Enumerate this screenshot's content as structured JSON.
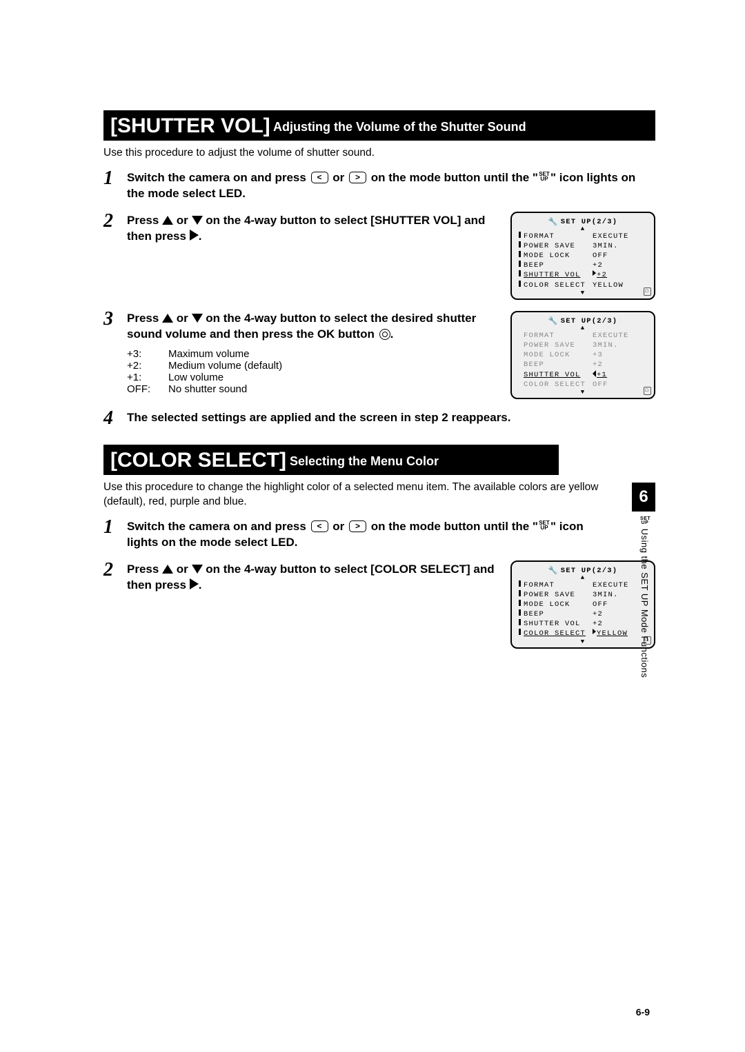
{
  "section1": {
    "header_bracket": "[SHUTTER VOL]",
    "header_sub": " Adjusting the Volume of the Shutter Sound",
    "intro": "Use this procedure to adjust the volume of shutter sound.",
    "steps": {
      "s1": {
        "num": "1",
        "pre": "Switch the camera on and press ",
        "mid": " or ",
        "post1": " on the mode button until the \"",
        "post2": "\" icon lights on the mode select LED.",
        "setup_top": "SET",
        "setup_bot": "UP"
      },
      "s2": {
        "num": "2",
        "pre": "Press ",
        "mid": " or ",
        "post": " on the 4-way button to select [SHUTTER VOL] and then press ",
        "end": "."
      },
      "s3": {
        "num": "3",
        "pre": "Press ",
        "mid": " or ",
        "post": " on the 4-way button to select the desired shutter sound volume and then press the OK button ",
        "end": "."
      },
      "s4": {
        "num": "4",
        "text": "The selected settings are applied and the screen in step 2 reappears."
      }
    },
    "vol_levels": [
      {
        "k": "+3:",
        "v": "Maximum volume"
      },
      {
        "k": "+2:",
        "v": "Medium volume (default)"
      },
      {
        "k": "+1:",
        "v": "Low volume"
      },
      {
        "k": "OFF:",
        "v": "No shutter sound"
      }
    ]
  },
  "section2": {
    "header_bracket": "[COLOR SELECT]",
    "header_sub": " Selecting the Menu Color",
    "intro": "Use this procedure to change the highlight color of a selected menu item. The available colors are yellow (default), red, purple and blue.",
    "steps": {
      "s1": {
        "num": "1",
        "pre": "Switch the camera on and press ",
        "mid": " or ",
        "post1": " on the mode button until the \"",
        "post2": "\" icon lights on the mode select LED.",
        "setup_top": "SET",
        "setup_bot": "UP"
      },
      "s2": {
        "num": "2",
        "pre": "Press ",
        "mid": " or ",
        "post": " on the 4-way button to select [COLOR SELECT] and then press ",
        "end": "."
      }
    }
  },
  "lcd1": {
    "title": "SET UP(2/3)",
    "rows": [
      {
        "l": "FORMAT",
        "v": "EXECUTE"
      },
      {
        "l": "POWER SAVE",
        "v": "3MIN."
      },
      {
        "l": "MODE LOCK",
        "v": "OFF"
      },
      {
        "l": "BEEP",
        "v": "+2"
      },
      {
        "l": "SHUTTER VOL",
        "v": "+2"
      },
      {
        "l": "COLOR SELECT",
        "v": "YELLOW"
      }
    ],
    "highlight_idx": 4
  },
  "lcd2": {
    "title": "SET UP(2/3)",
    "rows": [
      {
        "l": "FORMAT",
        "v": "EXECUTE"
      },
      {
        "l": "POWER SAVE",
        "v": "3MIN."
      },
      {
        "l": "MODE LOCK",
        "v": "+3"
      },
      {
        "l": "BEEP",
        "v": "+2"
      },
      {
        "l": "SHUTTER VOL",
        "v": "+1"
      },
      {
        "l": "COLOR SELECT",
        "v": "OFF"
      }
    ],
    "highlight_idx": 4
  },
  "lcd3": {
    "title": "SET UP(2/3)",
    "rows": [
      {
        "l": "FORMAT",
        "v": "EXECUTE"
      },
      {
        "l": "POWER SAVE",
        "v": "3MIN."
      },
      {
        "l": "MODE LOCK",
        "v": "OFF"
      },
      {
        "l": "BEEP",
        "v": "+2"
      },
      {
        "l": "SHUTTER VOL",
        "v": "+2"
      },
      {
        "l": "COLOR SELECT",
        "v": "YELLOW"
      }
    ],
    "highlight_idx": 5
  },
  "side": {
    "chapter": "6",
    "label": " Using the SET UP Mode Functions",
    "setup_top": "SET",
    "setup_bot": "UP"
  },
  "page_num": "6-9",
  "icon_lt": "<",
  "icon_gt": ">"
}
